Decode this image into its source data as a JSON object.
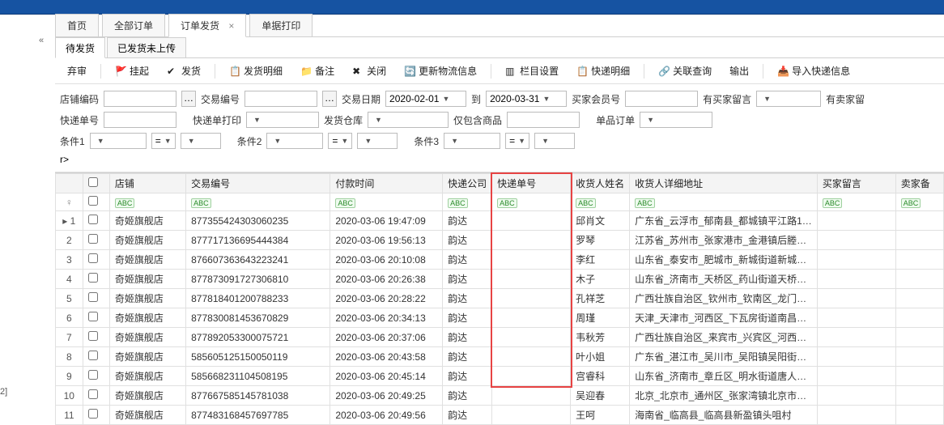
{
  "tabs": {
    "home": "首页",
    "all": "全部订单",
    "ship": "订单发货",
    "print": "单据打印"
  },
  "subtabs": {
    "pending": "待发货",
    "shipped_unsync": "已发货未上传"
  },
  "toolbar": {
    "reject": "弃审",
    "hold": "挂起",
    "ship": "发货",
    "detail": "发货明细",
    "remark": "备注",
    "close": "关闭",
    "refreshlog": "更新物流信息",
    "colset": "栏目设置",
    "courierdetail": "快递明细",
    "relquery": "关联查询",
    "export": "输出",
    "importcourier": "导入快递信息"
  },
  "filters": {
    "shopcode_l": "店铺编码",
    "tradeno_l": "交易编号",
    "tradedate_l": "交易日期",
    "to_l": "到",
    "tradedate_from": "2020-02-01",
    "tradedate_to": "2020-03-31",
    "buyerid_l": "买家会员号",
    "hasbuyermsg_l": "有买家留言",
    "hassellermsg_l": "有卖家留",
    "trackno_l": "快递单号",
    "printed_l": "快递单打印",
    "shipwh_l": "发货仓库",
    "onlygoods_l": "仅包含商品",
    "singleorder_l": "单品订单",
    "cond1_l": "条件1",
    "cond2_l": "条件2",
    "cond3_l": "条件3",
    "eq": "="
  },
  "columns": {
    "shop": "店铺",
    "tradeno": "交易编号",
    "paytime": "付款时间",
    "courier": "快递公司",
    "trackno": "快递单号",
    "recvname": "收货人姓名",
    "recvaddr": "收货人详细地址",
    "buyermsg": "买家留言",
    "sellermsg": "卖家备"
  },
  "filter_badge": "ABC",
  "row_marker": "▸",
  "rows": [
    {
      "idx": "1",
      "shop": "奇姬旗舰店",
      "tradeno": "877355424303060235",
      "paytime": "2020-03-06 19:47:09",
      "courier": "韵达",
      "recv": "邱肖文",
      "addr": "广东省_云浮市_郁南县_都城镇平江路1…"
    },
    {
      "idx": "2",
      "shop": "奇姬旗舰店",
      "tradeno": "877717136695444384",
      "paytime": "2020-03-06 19:56:13",
      "courier": "韵达",
      "recv": "罗琴",
      "addr": "江苏省_苏州市_张家港市_金港镇后塍…"
    },
    {
      "idx": "3",
      "shop": "奇姬旗舰店",
      "tradeno": "876607363643223241",
      "paytime": "2020-03-06 20:10:08",
      "courier": "韵达",
      "recv": "李红",
      "addr": "山东省_泰安市_肥城市_新城街道新城…"
    },
    {
      "idx": "4",
      "shop": "奇姬旗舰店",
      "tradeno": "877873091727306810",
      "paytime": "2020-03-06 20:26:38",
      "courier": "韵达",
      "recv": "木子",
      "addr": "山东省_济南市_天桥区_药山街道天桥…"
    },
    {
      "idx": "5",
      "shop": "奇姬旗舰店",
      "tradeno": "877818401200788233",
      "paytime": "2020-03-06 20:28:22",
      "courier": "韵达",
      "recv": "孔祥芝",
      "addr": "广西壮族自治区_钦州市_钦南区_龙门…"
    },
    {
      "idx": "6",
      "shop": "奇姬旗舰店",
      "tradeno": "877830081453670829",
      "paytime": "2020-03-06 20:34:13",
      "courier": "韵达",
      "recv": "周瑾",
      "addr": "天津_天津市_河西区_下瓦房街道南昌…"
    },
    {
      "idx": "7",
      "shop": "奇姬旗舰店",
      "tradeno": "877892053300075721",
      "paytime": "2020-03-06 20:37:06",
      "courier": "韵达",
      "recv": "韦秋芳",
      "addr": "广西壮族自治区_来宾市_兴宾区_河西…"
    },
    {
      "idx": "8",
      "shop": "奇姬旗舰店",
      "tradeno": "585605125150050119",
      "paytime": "2020-03-06 20:43:58",
      "courier": "韵达",
      "recv": "叶小姐",
      "addr": "广东省_湛江市_吴川市_吴阳镇吴阳街…"
    },
    {
      "idx": "9",
      "shop": "奇姬旗舰店",
      "tradeno": "585668231104508195",
      "paytime": "2020-03-06 20:45:14",
      "courier": "韵达",
      "recv": "宫睿科",
      "addr": "山东省_济南市_章丘区_明水街道唐人…"
    },
    {
      "idx": "10",
      "shop": "奇姬旗舰店",
      "tradeno": "877667585145781038",
      "paytime": "2020-03-06 20:49:25",
      "courier": "韵达",
      "recv": "吴迎春",
      "addr": "北京_北京市_通州区_张家湾镇北京市…"
    },
    {
      "idx": "11",
      "shop": "奇姬旗舰店",
      "tradeno": "877483168457697785",
      "paytime": "2020-03-06 20:49:56",
      "courier": "韵达",
      "recv": "王呵",
      "addr": "海南省_临高县_临高县新盈镇头咀村"
    }
  ]
}
